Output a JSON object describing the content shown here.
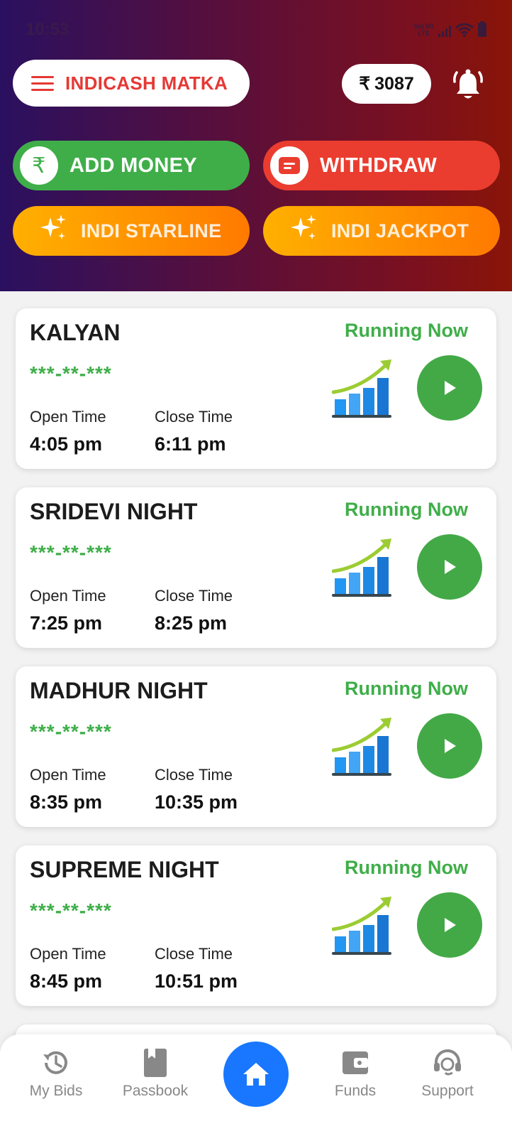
{
  "status_bar": {
    "time": "10:53",
    "network_top": "Vo) 5G",
    "network_bottom": "LTE"
  },
  "header": {
    "brand": "INDICASH MATKA",
    "wallet_symbol": "₹",
    "wallet_balance": "3087"
  },
  "actions": {
    "add_money": "ADD MONEY",
    "add_money_symbol": "₹",
    "withdraw": "WITHDRAW",
    "starline": "INDI STARLINE",
    "jackpot": "INDI JACKPOT"
  },
  "labels": {
    "open_time": "Open Time",
    "close_time": "Close Time"
  },
  "markets": [
    {
      "name": "KALYAN",
      "result": "***-**-***",
      "status": "Running Now",
      "open": "4:05 pm",
      "close": "6:11 pm"
    },
    {
      "name": "SRIDEVI NIGHT",
      "result": "***-**-***",
      "status": "Running Now",
      "open": "7:25 pm",
      "close": "8:25 pm"
    },
    {
      "name": "MADHUR NIGHT",
      "result": "***-**-***",
      "status": "Running Now",
      "open": "8:35 pm",
      "close": "10:35 pm"
    },
    {
      "name": "SUPREME NIGHT",
      "result": "***-**-***",
      "status": "Running Now",
      "open": "8:45 pm",
      "close": "10:51 pm"
    }
  ],
  "nav": {
    "my_bids": "My Bids",
    "passbook": "Passbook",
    "funds": "Funds",
    "support": "Support"
  },
  "colors": {
    "brand_red": "#e53935",
    "green": "#3fae49",
    "orange": "#ff9000",
    "home_blue": "#1977ff"
  }
}
